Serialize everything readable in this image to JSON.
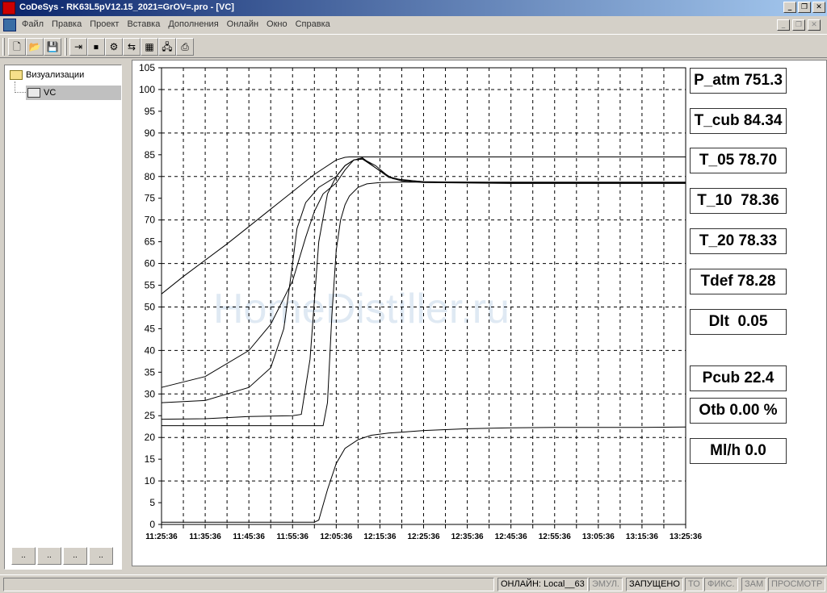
{
  "window": {
    "title": "CoDeSys - RK63L5pV12.15_2021=GrOV=.pro - [VC]",
    "min_glyph": "_",
    "max_glyph": "❐",
    "close_glyph": "✕"
  },
  "menu": {
    "items": [
      "Файл",
      "Правка",
      "Проект",
      "Вставка",
      "Дополнения",
      "Онлайн",
      "Окно",
      "Справка"
    ]
  },
  "toolbar": {
    "buttons": [
      {
        "name": "new-icon",
        "glyph": "🗋"
      },
      {
        "name": "open-icon",
        "glyph": "📂"
      },
      {
        "name": "save-icon",
        "glyph": "💾"
      },
      {
        "name": "login-icon",
        "glyph": "⇥"
      },
      {
        "name": "stop-icon",
        "glyph": "⏹"
      },
      {
        "name": "step-icon",
        "glyph": "⚙"
      },
      {
        "name": "write-icon",
        "glyph": "⇆"
      },
      {
        "name": "watch-icon",
        "glyph": "▦"
      },
      {
        "name": "network-icon",
        "glyph": "🖧"
      },
      {
        "name": "print-icon",
        "glyph": "⎙"
      }
    ]
  },
  "tree": {
    "root_label": "Визуализации",
    "child_label": "VC"
  },
  "tabs": [
    {
      "name": "tab-pou",
      "label": ".."
    },
    {
      "name": "tab-datatypes",
      "label": ".."
    },
    {
      "name": "tab-visualizations",
      "label": ".."
    },
    {
      "name": "tab-resources",
      "label": ".."
    }
  ],
  "chart_data": {
    "type": "line",
    "ylim": [
      0,
      105
    ],
    "y_ticks": [
      0,
      5,
      10,
      15,
      20,
      25,
      30,
      35,
      40,
      45,
      50,
      55,
      60,
      65,
      70,
      75,
      80,
      85,
      90,
      95,
      100,
      105
    ],
    "x_ticks": [
      "11:25:36",
      "11:35:36",
      "11:45:36",
      "11:55:36",
      "12:05:36",
      "12:15:36",
      "12:25:36",
      "12:35:36",
      "12:45:36",
      "12:55:36",
      "13:05:36",
      "13:15:36",
      "13:25:36"
    ],
    "grid": true,
    "series": [
      {
        "x": [
          0,
          0.5,
          1.5,
          2,
          2.5,
          3,
          3.5,
          4.0,
          4.2,
          4.3,
          4.5,
          4.7,
          5,
          6,
          7,
          8,
          9,
          10,
          11,
          12
        ],
        "values": [
          53,
          57,
          64.5,
          68.5,
          72.5,
          76.5,
          80.5,
          83.8,
          84.4,
          84.5,
          84.5,
          84.5,
          84.5,
          84.5,
          84.5,
          84.5,
          84.5,
          84.5,
          84.5,
          84.5
        ]
      },
      {
        "x": [
          0,
          1,
          2,
          2.5,
          3,
          3.3,
          3.5,
          3.7,
          4.0,
          4.2,
          4.4,
          4.6,
          4.9,
          5.2,
          5.5,
          6,
          8,
          10,
          12
        ],
        "values": [
          31.5,
          34,
          40,
          46,
          56,
          66,
          72,
          76,
          78.5,
          81.5,
          83.8,
          84.3,
          82,
          79.8,
          79,
          78.6,
          78.4,
          78.4,
          78.4
        ]
      },
      {
        "x": [
          0,
          1,
          2,
          2.5,
          2.8,
          3.0,
          3.1,
          3.3,
          3.6,
          4.0,
          4.2,
          4.4,
          4.6,
          4.9,
          5.2,
          5.5,
          6,
          8,
          10,
          12
        ],
        "values": [
          28,
          28.5,
          31.5,
          36,
          45,
          60,
          68,
          74,
          77.5,
          80,
          82.5,
          83.8,
          84.1,
          82.5,
          80,
          79.2,
          78.8,
          78.5,
          78.5,
          78.5
        ]
      },
      {
        "x": [
          0,
          1,
          2,
          3.0,
          3.2,
          3.4,
          3.6,
          3.8,
          4.0,
          4.2,
          4.4,
          4.6,
          4.9,
          5.3,
          6,
          8,
          10,
          12
        ],
        "values": [
          24.2,
          24.3,
          24.8,
          25,
          25.3,
          38,
          65,
          76,
          80,
          82.5,
          83.8,
          84,
          82,
          79.5,
          78.8,
          78.6,
          78.6,
          78.6
        ]
      },
      {
        "x": [
          0,
          1,
          2,
          3,
          3.7,
          3.8,
          3.9,
          4.0,
          4.1,
          4.2,
          4.3,
          4.5,
          4.7,
          5,
          5.5,
          6,
          8,
          10,
          12
        ],
        "values": [
          22.7,
          22.7,
          22.7,
          22.7,
          22.7,
          28,
          48,
          63,
          70,
          73.5,
          75.5,
          77.5,
          78.3,
          78.6,
          78.7,
          78.7,
          78.7,
          78.7,
          78.7
        ]
      },
      {
        "x": [
          0,
          3.5,
          3.6,
          3.8,
          4.0,
          4.2,
          4.5,
          4.8,
          5.2,
          5.6,
          6,
          7,
          8,
          9,
          10,
          11,
          12
        ],
        "values": [
          0.5,
          0.5,
          1,
          8,
          14,
          17.5,
          19.5,
          20.5,
          21,
          21.3,
          21.6,
          22,
          22.2,
          22.3,
          22.3,
          22.3,
          22.4
        ]
      }
    ]
  },
  "readouts": [
    {
      "name": "p-atm-readout",
      "text": "P_atm 751.3"
    },
    {
      "name": "t-cub-readout",
      "text": "T_cub 84.34"
    },
    {
      "name": "t-05-readout",
      "text": "T_05 78.70"
    },
    {
      "name": "t-10-readout",
      "text": "T_10  78.36"
    },
    {
      "name": "t-20-readout",
      "text": "T_20 78.33"
    },
    {
      "name": "tdef-readout",
      "text": "Tdef 78.28"
    },
    {
      "name": "dlt-readout",
      "text": "Dlt  0.05"
    },
    {
      "name": "pcub-readout",
      "text": "Pcub 22.4"
    },
    {
      "name": "otb-readout",
      "text": "Otb 0.00 %"
    },
    {
      "name": "mlh-readout",
      "text": "Ml/h 0.0"
    }
  ],
  "watermark": "HomeDistiller.ru",
  "status": {
    "online": "ОНЛАЙН: Local__63",
    "emul": "ЭМУЛ.",
    "running": "ЗАПУЩЕНО",
    "to": "ТО",
    "fix": "ФИКС.",
    "zam": "ЗАМ",
    "view": "ПРОСМОТР"
  }
}
